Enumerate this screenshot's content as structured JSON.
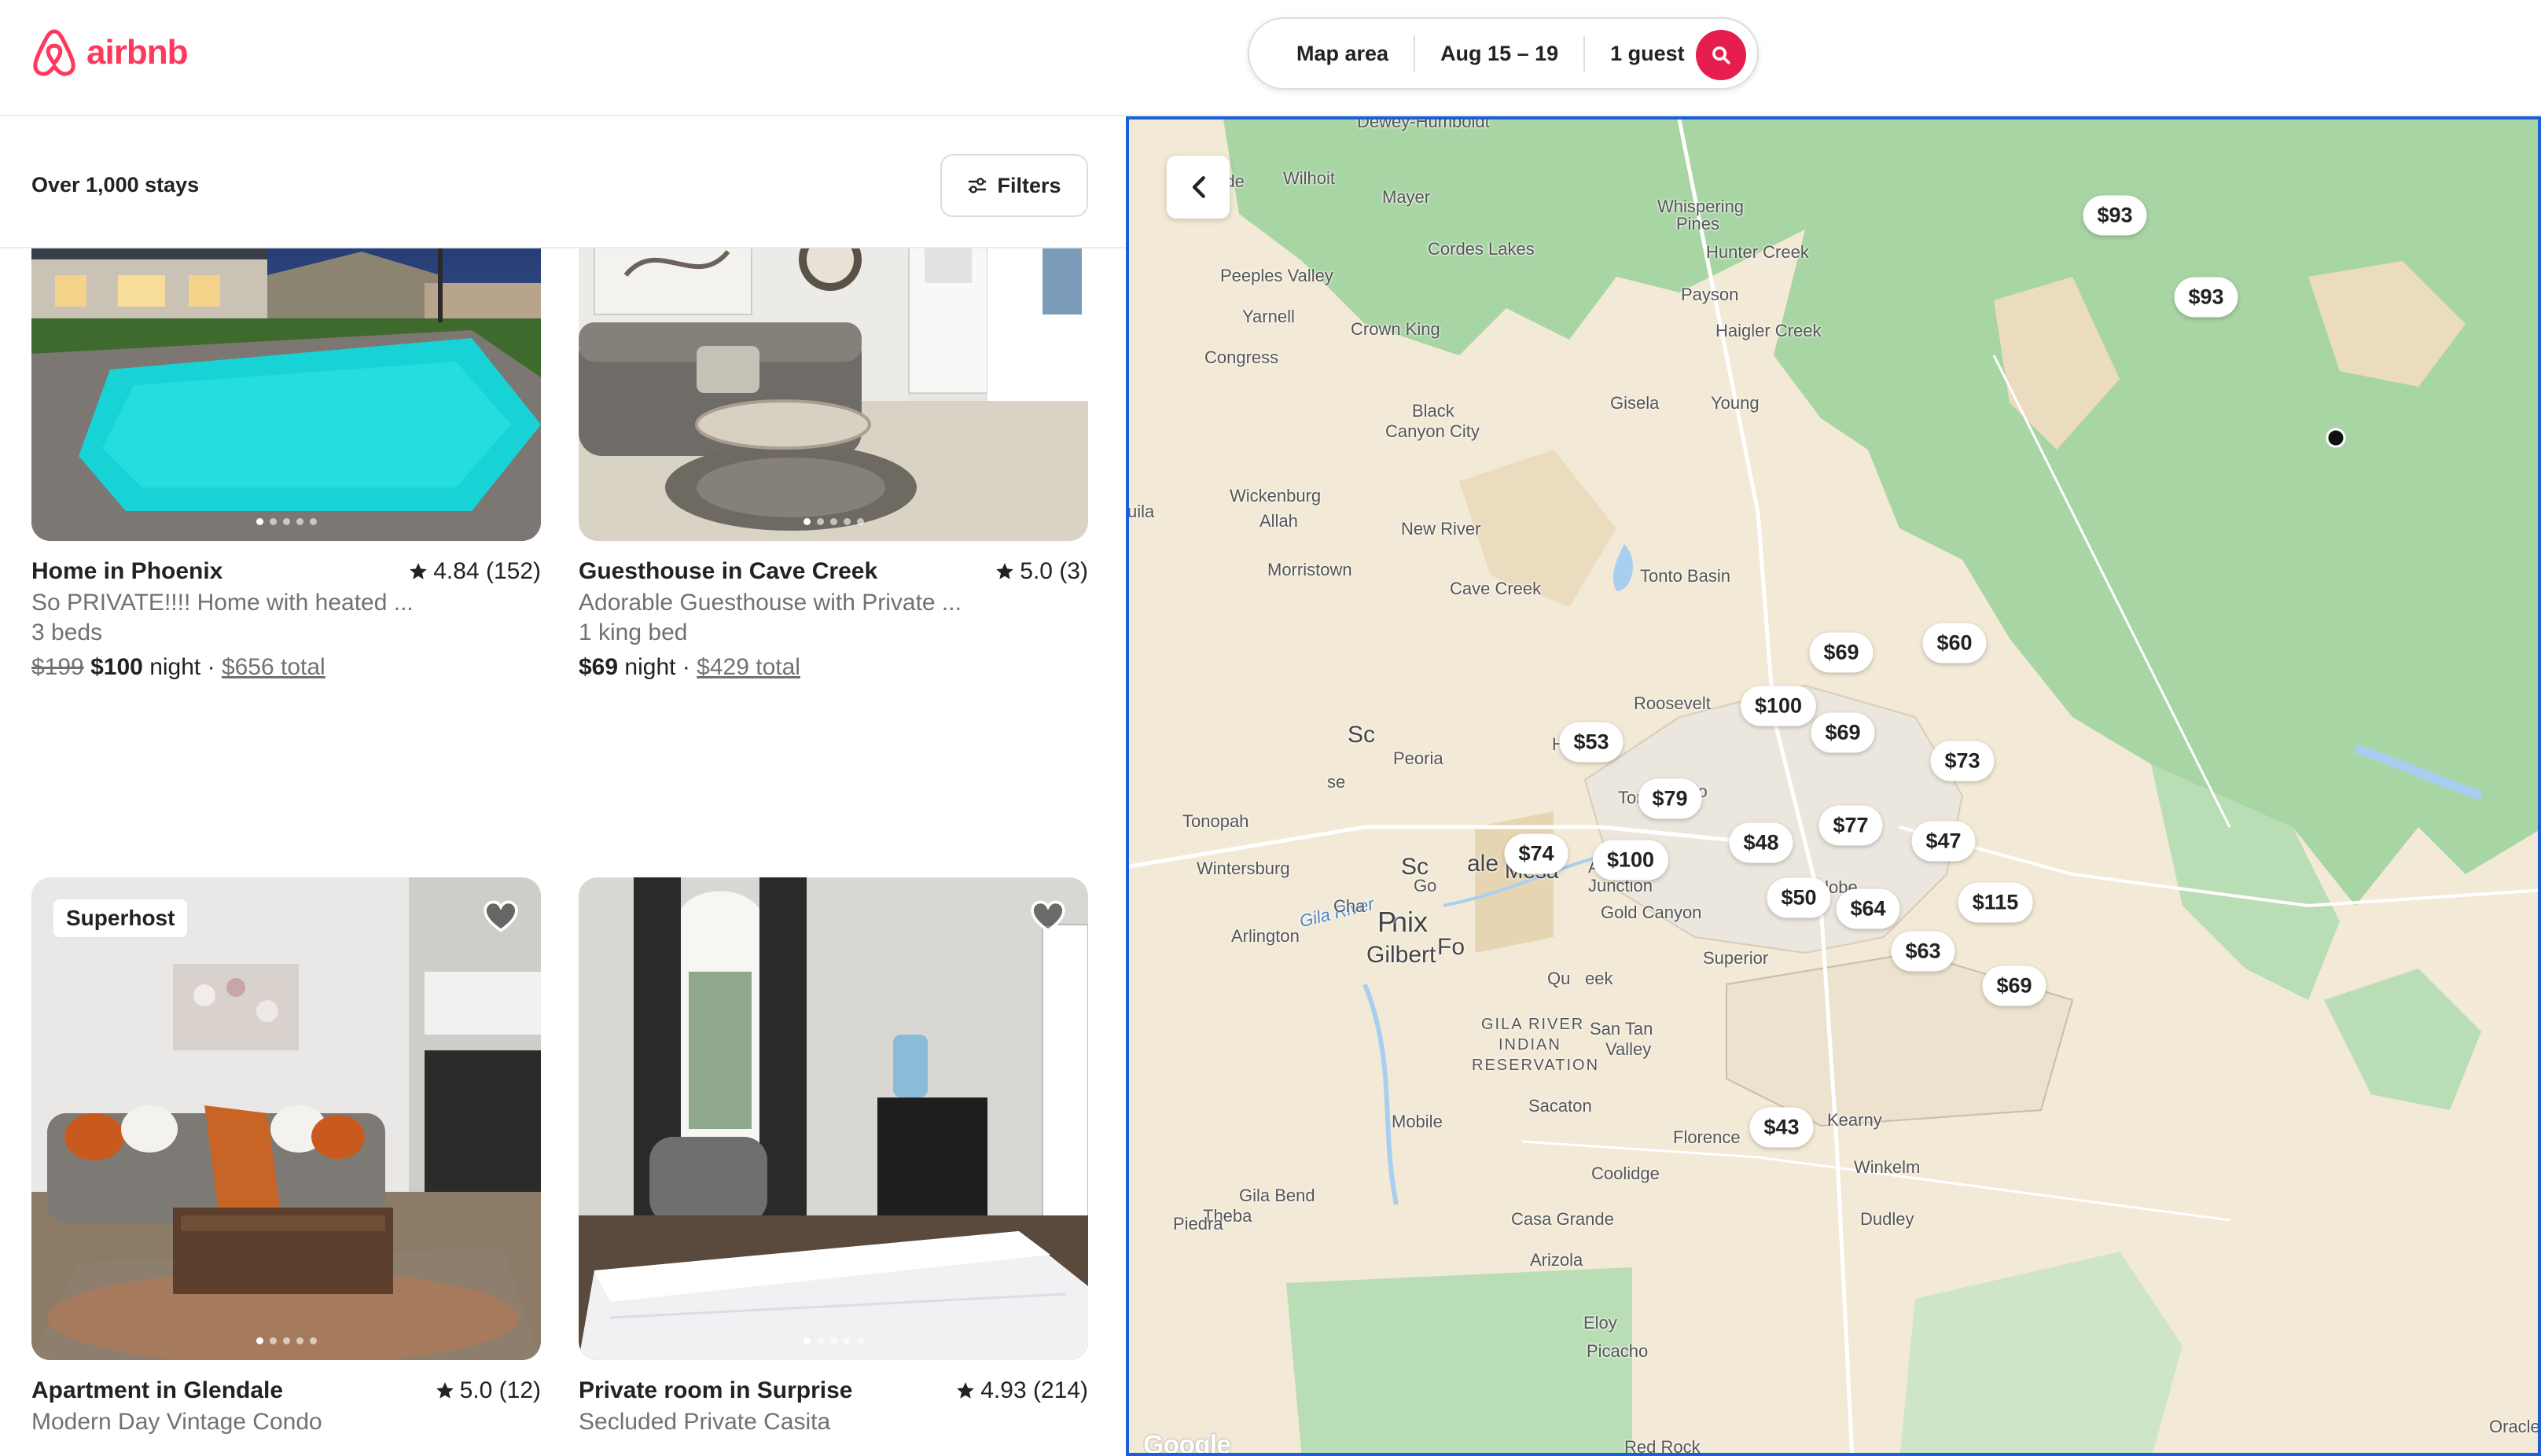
{
  "header": {
    "logo_text": "airbnb",
    "search": {
      "location": "Map area",
      "dates": "Aug 15 – 19",
      "guests": "1 guest"
    }
  },
  "results": {
    "count_label": "Over 1,000 stays",
    "filters_label": "Filters",
    "cards": [
      {
        "title": "Home in Phoenix",
        "rating": "4.84 (152)",
        "subtitle": "So PRIVATE!!!! Home with heated ...",
        "detail": "3 beds",
        "price_old": "$199",
        "price_now": "$100",
        "price_unit": "night",
        "separator": "·",
        "price_total": "$656 total"
      },
      {
        "title": "Guesthouse in Cave Creek",
        "rating": "5.0 (3)",
        "subtitle": "Adorable Guesthouse with Private ...",
        "detail": "1 king bed",
        "price_now": "$69",
        "price_unit": "night",
        "separator": "·",
        "price_total": "$429 total"
      },
      {
        "badge": "Superhost",
        "title": "Apartment in Glendale",
        "rating": "5.0 (12)",
        "subtitle": "Modern Day Vintage Condo"
      },
      {
        "title": "Private room in Surprise",
        "rating": "4.93 (214)",
        "subtitle": "Secluded Private Casita"
      }
    ]
  },
  "map": {
    "places": [
      "Dewey-Humboldt",
      "Hillside",
      "Wilhoit",
      "Mayer",
      "Whispering",
      "Pines",
      "Cordes Lakes",
      "Hunter Creek",
      "Peeples Valley",
      "Yarnell",
      "Crown King",
      "Haigler Creek",
      "Congress",
      "Gisela",
      "Young",
      "Black",
      "Canyon City",
      "Wickenburg",
      "Allah",
      "uila",
      "New River",
      "Morristown",
      "Cave Creek",
      "Tonto Basin",
      "Roosevelt",
      "Peoria",
      "Hills",
      "Tonopah",
      "Tortilla Flat",
      "Wintersburg",
      "Mesa",
      "Apache",
      "Junction",
      "Globe",
      "Arlington",
      "Gold Canyon",
      "Gila River",
      "Superior",
      "San Tan",
      "Valley",
      "GILA RIVER",
      "INDIAN",
      "RESERVATION",
      "Mobile",
      "Sacaton",
      "Florence",
      "Kearny",
      "Coolidge",
      "Winkelm",
      "Gila Bend",
      "Theba",
      "Piedra",
      "Casa Grande",
      "Dudley",
      "Arizola",
      "Eloy",
      "Picacho",
      "Red Rock",
      "Oracle",
      "Google",
      "ndale",
      "nix",
      "P",
      "Sc",
      "ale",
      "Go",
      "Cha",
      "Gilbert",
      "Fo",
      "se",
      "Qu",
      "eek",
      "Payson"
    ],
    "price_pins": [
      "$93",
      "$93",
      "$69",
      "$60",
      "$100",
      "$69",
      "$53",
      "$73",
      "$79",
      "$77",
      "$48",
      "$47",
      "$74",
      "$100",
      "$50",
      "$64",
      "$115",
      "$63",
      "$69",
      "$43"
    ]
  }
}
